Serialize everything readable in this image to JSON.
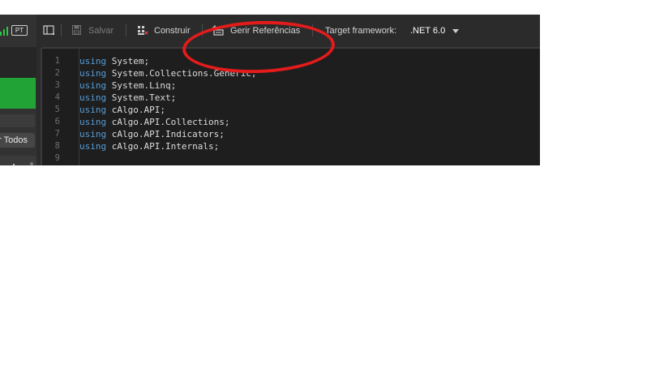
{
  "header": {
    "language_badge": "PT"
  },
  "left_panel": {
    "todos_button_label": "r Todos"
  },
  "toolbar": {
    "salvar_label": "Salvar",
    "construir_label": "Construir",
    "gerir_label": "Gerir Referências",
    "framework_label": "Target framework:",
    "framework_value": ".NET 6.0"
  },
  "editor": {
    "line_numbers": [
      "1",
      "2",
      "3",
      "4",
      "5",
      "6",
      "7",
      "8",
      "9"
    ],
    "lines": [
      {
        "keyword": "using",
        "text": " System;"
      },
      {
        "keyword": "using",
        "text": " System.Collections.Generic;"
      },
      {
        "keyword": "using",
        "text": " System.Linq;"
      },
      {
        "keyword": "using",
        "text": " System.Text;"
      },
      {
        "keyword": "using",
        "text": " cAlgo.API;"
      },
      {
        "keyword": "using",
        "text": " cAlgo.API.Collections;"
      },
      {
        "keyword": "using",
        "text": " cAlgo.API.Indicators;"
      },
      {
        "keyword": "using",
        "text": " cAlgo.API.Internals;"
      },
      {
        "keyword": "",
        "text": ""
      }
    ]
  },
  "colors": {
    "accent_green": "#21a336",
    "annotation_red": "#e41b1b",
    "keyword_blue": "#569cd6"
  }
}
